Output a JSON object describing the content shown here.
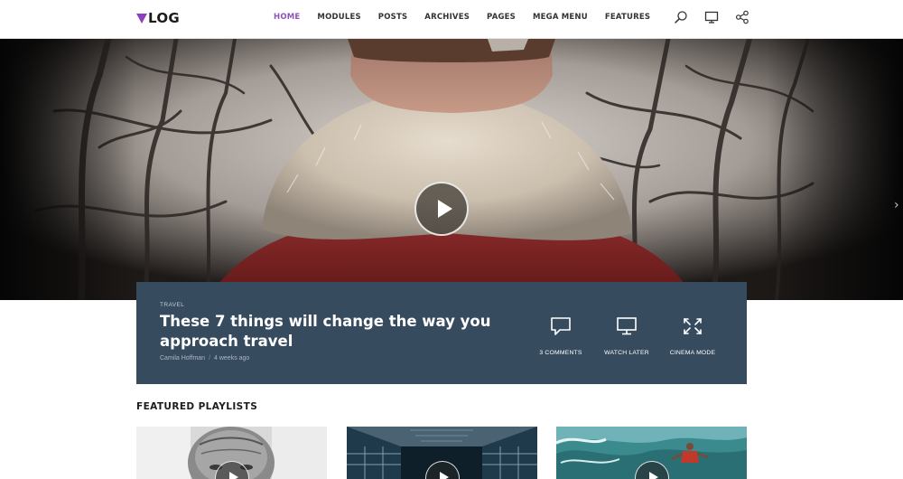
{
  "brand": {
    "logo_text": "LOG",
    "accent": "#8e52b8"
  },
  "nav": {
    "items": [
      {
        "label": "HOME",
        "active": true
      },
      {
        "label": "MODULES",
        "active": false
      },
      {
        "label": "POSTS",
        "active": false
      },
      {
        "label": "ARCHIVES",
        "active": false
      },
      {
        "label": "PAGES",
        "active": false
      },
      {
        "label": "MEGA MENU",
        "active": false
      },
      {
        "label": "FEATURES",
        "active": false
      }
    ],
    "icons": [
      "search-icon",
      "monitor-icon",
      "share-icon"
    ]
  },
  "hero": {
    "play_icon": "play-icon",
    "next_icon": "chevron-right-icon",
    "next_glyph": "›"
  },
  "post": {
    "category": "TRAVEL",
    "title": "These 7 things will change the way you approach travel",
    "author": "Camila Hoffman",
    "separator": "/",
    "time": "4 weeks ago",
    "panel_color": "#374b5f",
    "actions": [
      {
        "label": "3 COMMENTS",
        "icon": "comment-icon"
      },
      {
        "label": "WATCH LATER",
        "icon": "monitor-icon"
      },
      {
        "label": "CINEMA MODE",
        "icon": "expand-icon"
      }
    ]
  },
  "featured": {
    "heading": "FEATURED PLAYLISTS",
    "cards": [
      {
        "thumbnail": "elderly-man-portrait",
        "play_icon": "play-icon"
      },
      {
        "thumbnail": "building-corridor",
        "play_icon": "play-icon"
      },
      {
        "thumbnail": "surfer-wave",
        "play_icon": "play-icon"
      }
    ]
  }
}
